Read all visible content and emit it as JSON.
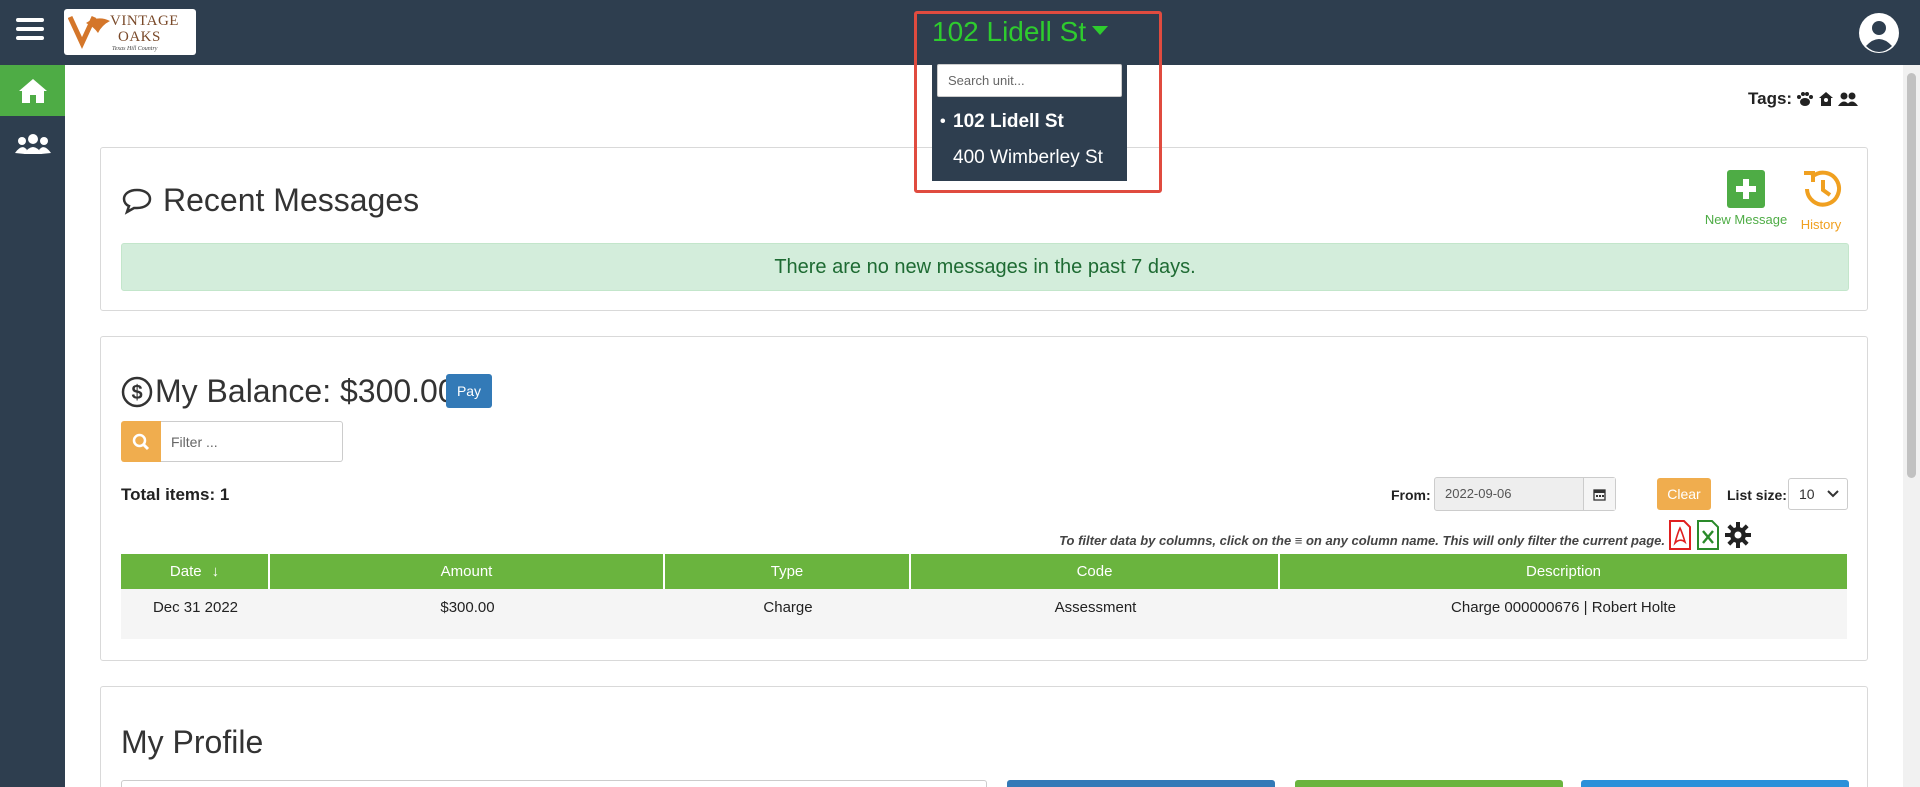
{
  "header": {
    "logo_line1": "VINTAGE",
    "logo_line2": "OAKS",
    "logo_tagline": "Texas Hill Country"
  },
  "unit_selector": {
    "current": "102 Lidell St",
    "search_placeholder": "Search unit...",
    "options": [
      {
        "label": "102 Lidell St",
        "active": true,
        "bullet": "•"
      },
      {
        "label": "400 Wimberley St",
        "active": false,
        "bullet": ""
      }
    ]
  },
  "tags": {
    "label": "Tags:",
    "icons": [
      "paw-icon",
      "house-user-icon",
      "users-icon"
    ]
  },
  "messages": {
    "title": "Recent Messages",
    "new_message_label": "New Message",
    "history_label": "History",
    "alert": "There are no new messages in the past 7 days."
  },
  "balance": {
    "title": "My Balance: $300.00",
    "pay_label": "Pay",
    "filter_placeholder": "Filter ...",
    "total_items": "Total items: 1",
    "from_label": "From:",
    "from_value": "2022-09-06",
    "clear_label": "Clear",
    "list_size_label": "List size:",
    "list_size_value": "10",
    "hint": "To filter data by columns, click on the ≡ on any column name. This will only filter the current page.",
    "columns": [
      "Date",
      "Amount",
      "Type",
      "Code",
      "Description"
    ],
    "sort_indicator": "↓",
    "rows": [
      {
        "date": "Dec 31 2022",
        "amount": "$300.00",
        "type": "Charge",
        "code": "Assessment",
        "description": "Charge 000000676 | Robert Holte"
      }
    ]
  },
  "profile": {
    "title": "My Profile"
  },
  "colors": {
    "topbar": "#2e3e4f",
    "accent_green": "#4eac45",
    "unit_green": "#2ecc2e",
    "highlight_red": "#e04b3f",
    "warning_orange": "#f0ad4e",
    "primary_blue": "#337ab7"
  }
}
